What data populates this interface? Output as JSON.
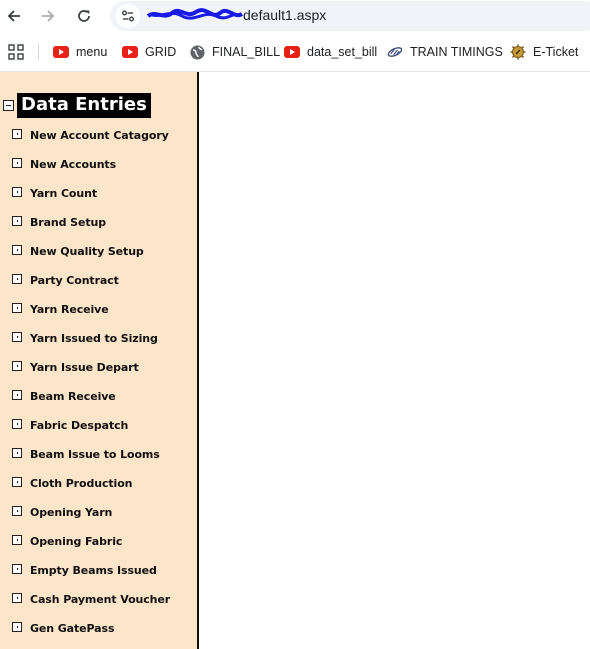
{
  "browser": {
    "nav": {
      "back_icon": "arrow-left-icon",
      "forward_icon": "arrow-right-icon",
      "reload_icon": "reload-icon"
    },
    "address_bar": {
      "site_info_icon": "tune-icon",
      "url_visible_suffix": "default1.aspx",
      "url_prefix_redacted": true
    },
    "bookmarks": [
      {
        "label": "menu",
        "icon": "youtube-icon"
      },
      {
        "label": "GRID",
        "icon": "youtube-icon"
      },
      {
        "label": "FINAL_BILL",
        "icon": "globe-icon"
      },
      {
        "label": "data_set_bill",
        "icon": "youtube-icon"
      },
      {
        "label": "TRAIN TIMINGS",
        "icon": "train-logo-icon"
      },
      {
        "label": "E-Ticket",
        "icon": "irctc-logo-icon"
      }
    ],
    "apps_icon": "apps-grid-icon"
  },
  "sidebar": {
    "root": {
      "label": "Data Entries",
      "expanded": true
    },
    "items": [
      {
        "label": "New Account Catagory"
      },
      {
        "label": "New Accounts"
      },
      {
        "label": "Yarn Count"
      },
      {
        "label": "Brand Setup"
      },
      {
        "label": "New Quality Setup"
      },
      {
        "label": "Party Contract"
      },
      {
        "label": "Yarn Receive"
      },
      {
        "label": "Yarn Issued to Sizing"
      },
      {
        "label": "Yarn Issue Depart"
      },
      {
        "label": "Beam Receive"
      },
      {
        "label": "Fabric Despatch"
      },
      {
        "label": "Beam Issue to Looms"
      },
      {
        "label": "Cloth Production"
      },
      {
        "label": "Opening Yarn"
      },
      {
        "label": "Opening Fabric"
      },
      {
        "label": "Empty Beams Issued"
      },
      {
        "label": "Cash Payment Voucher"
      },
      {
        "label": "Gen GatePass"
      }
    ]
  },
  "colors": {
    "sidebar_bg": "#fce5c8",
    "root_label_bg": "#000000",
    "root_label_fg": "#ffffff",
    "youtube_red": "#e62117"
  }
}
